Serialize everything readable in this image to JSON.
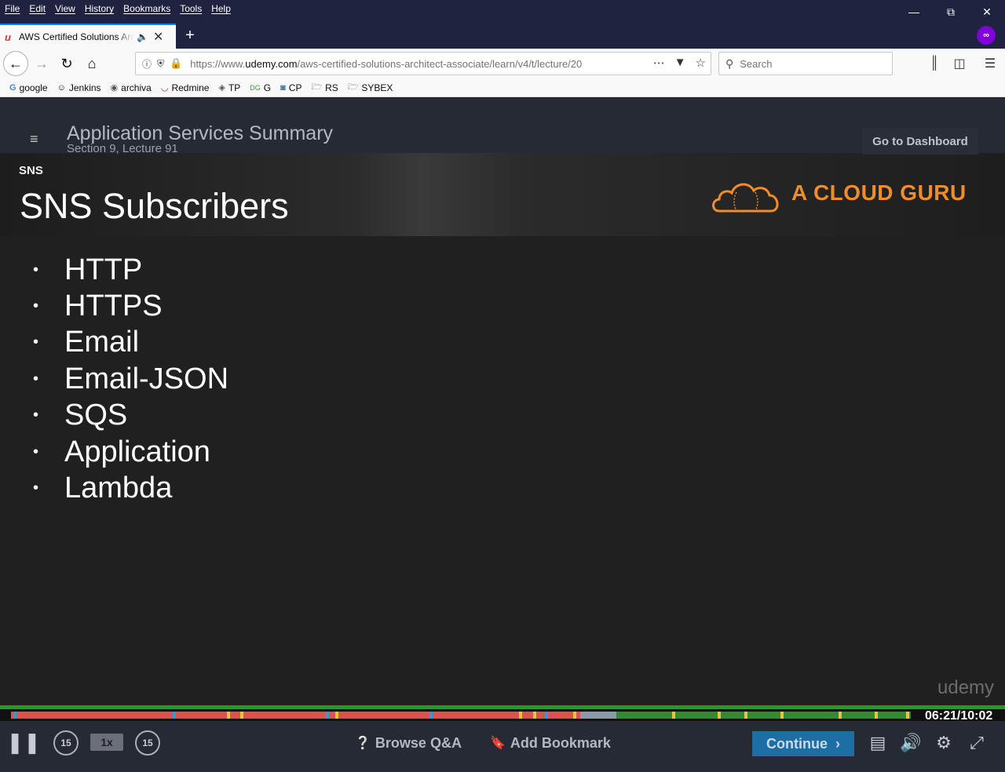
{
  "browser": {
    "menu": [
      "File",
      "Edit",
      "View",
      "History",
      "Bookmarks",
      "Tools",
      "Help"
    ],
    "tab_title": "AWS Certified Solutions Architect",
    "url_prefix": "https://www.",
    "url_domain": "udemy.com",
    "url_path": "/aws-certified-solutions-architect-associate/learn/v4/t/lecture/20",
    "search_placeholder": "Search",
    "bookmarks": [
      {
        "label": "google",
        "icon": "google-icon"
      },
      {
        "label": "Jenkins",
        "icon": "jenkins-icon"
      },
      {
        "label": "archiva",
        "icon": "archiva-icon"
      },
      {
        "label": "Redmine",
        "icon": "redmine-icon"
      },
      {
        "label": "TP",
        "icon": "tp-icon"
      },
      {
        "label": "G",
        "icon": "g-icon"
      },
      {
        "label": "CP",
        "icon": "cp-icon"
      },
      {
        "label": "RS",
        "icon": "folder-icon"
      },
      {
        "label": "SYBEX",
        "icon": "folder-icon"
      }
    ]
  },
  "lecture": {
    "title": "Application Services Summary",
    "subtitle": "Section 9, Lecture 91",
    "dashboard_label": "Go to Dashboard"
  },
  "slide": {
    "tag": "SNS",
    "title": "SNS Subscribers",
    "brand": "A CLOUD GURU",
    "bullets": [
      "HTTP",
      "HTTPS",
      "Email",
      "Email-JSON",
      "SQS",
      "Application",
      "Lambda"
    ],
    "watermark": "udemy"
  },
  "player": {
    "time": "06:21/10:02",
    "progress_fraction": 0.633,
    "speed_label": "1x",
    "skip_back_label": "15",
    "skip_fwd_label": "15",
    "qa_label": "Browse Q&A",
    "bookmark_label": "Add Bookmark",
    "continue_label": "Continue",
    "colors": {
      "watched": "#e0504e",
      "buffered": "#8a9aa6",
      "remaining": "#2c8d33",
      "marker_yellow": "#e8c62c",
      "marker_blue": "#2a9fd6",
      "accent": "#1d6ea3"
    }
  }
}
